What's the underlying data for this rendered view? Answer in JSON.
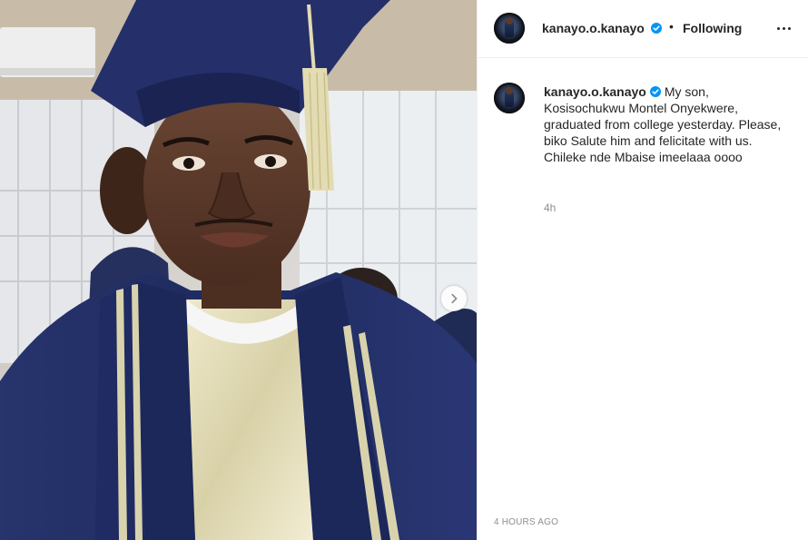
{
  "post": {
    "username": "kanayo.o.kanayo",
    "verified": true,
    "follow_status": "Following",
    "separator": "•",
    "caption": "My son, Kosisochukwu Montel Onyekwere, graduated from college yesterday. Please, biko Salute him and felicitate with us. Chileke nde Mbaise imeelaaa oooo",
    "relative_time": "4h",
    "timestamp": "4 HOURS AGO"
  },
  "icons": {
    "verified": "verified-badge-icon",
    "more": "more-options-icon",
    "next": "chevron-right-icon"
  },
  "colors": {
    "verified_blue": "#0095f6",
    "text": "#262626",
    "muted": "#8e8e8e",
    "gown_navy": "#1f2a5a",
    "tassel_gold": "#e3dcb2"
  }
}
